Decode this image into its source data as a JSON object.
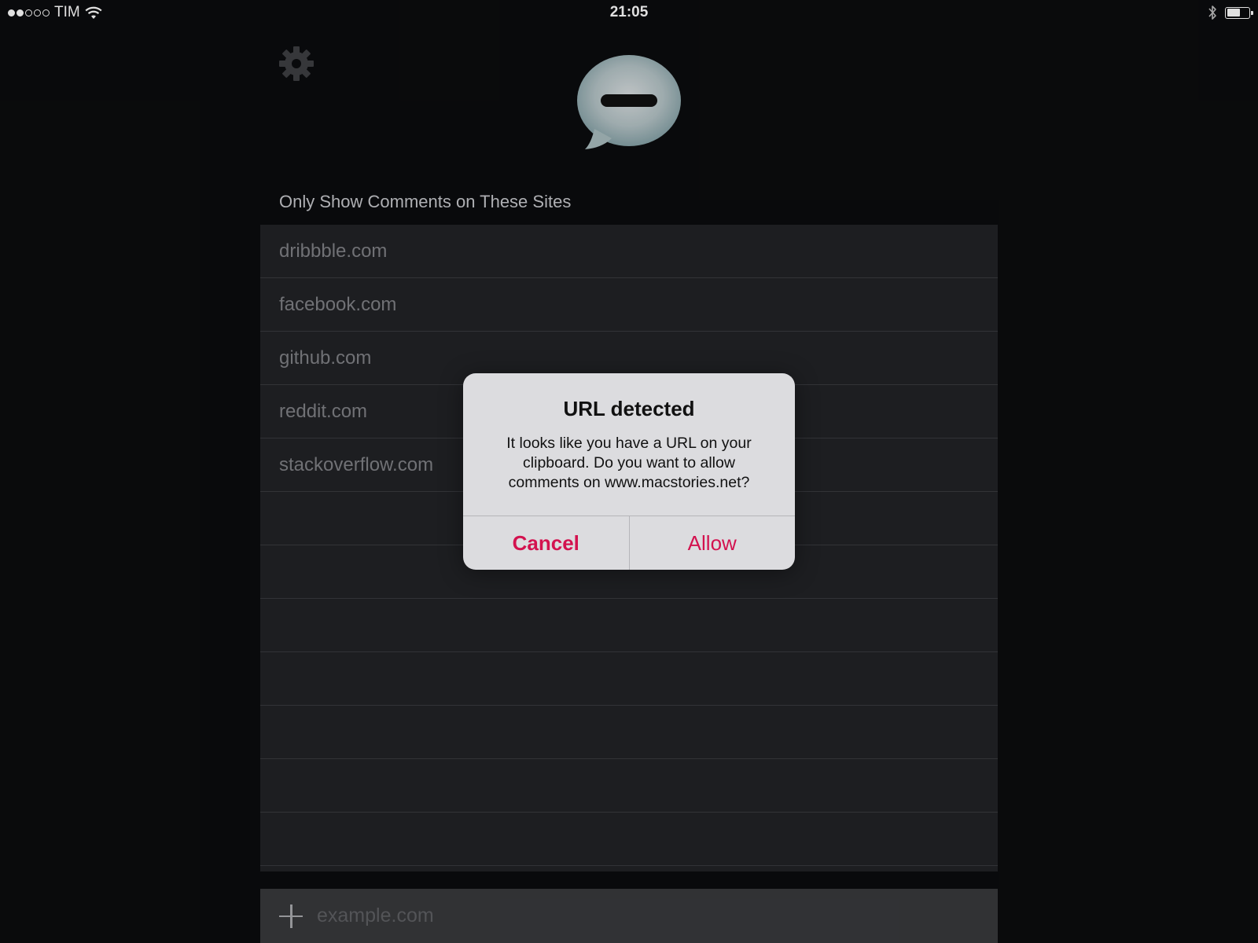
{
  "status_bar": {
    "carrier": "TIM",
    "time": "21:05",
    "signal_bars_filled": 2,
    "signal_bars_total": 5,
    "battery_level": 0.55,
    "icons": [
      "wifi-icon",
      "bluetooth-icon",
      "battery-icon"
    ]
  },
  "header": {
    "settings_icon": "gear-icon",
    "logo_icon": "speech-bubble-icon"
  },
  "section": {
    "title": "Only Show Comments on These Sites"
  },
  "sites": [
    {
      "label": "dribbble.com"
    },
    {
      "label": "facebook.com"
    },
    {
      "label": "github.com"
    },
    {
      "label": "reddit.com"
    },
    {
      "label": "stackoverflow.com"
    },
    {
      "label": ""
    },
    {
      "label": ""
    },
    {
      "label": ""
    },
    {
      "label": ""
    },
    {
      "label": ""
    },
    {
      "label": ""
    },
    {
      "label": ""
    }
  ],
  "add_bar": {
    "icon": "plus-icon",
    "placeholder": "example.com",
    "value": ""
  },
  "alert": {
    "title": "URL detected",
    "message": "It looks like you have a URL on your clipboard. Do you want to allow comments on www.macstories.net?",
    "cancel_label": "Cancel",
    "allow_label": "Allow",
    "accent_color": "#d3124f"
  },
  "colors": {
    "background": "#0b0c0e",
    "list_background": "#222326",
    "row_text": "#808186",
    "alert_background": "#dcdcdf"
  }
}
